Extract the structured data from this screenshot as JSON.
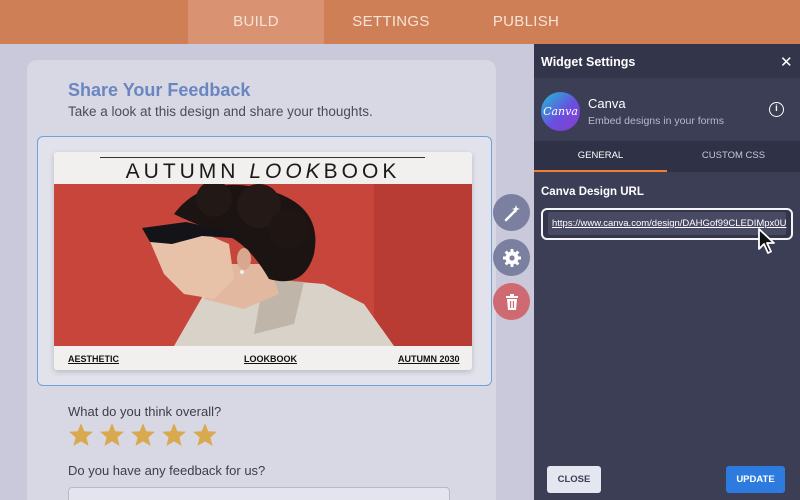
{
  "topnav": {
    "tabs": [
      {
        "label": "BUILD",
        "active": true
      },
      {
        "label": "SETTINGS",
        "active": false
      },
      {
        "label": "PUBLISH",
        "active": false
      }
    ],
    "color": "#cf7f55"
  },
  "form": {
    "title": "Share Your Feedback",
    "subtitle": "Take a look at this design and share your thoughts.",
    "lookbook": {
      "title_pre": "AUTUMN ",
      "title_em": "LOOK",
      "title_post": "BOOK",
      "footer": [
        "AESTHETIC",
        "LOOKBOOK",
        "AUTUMN 2030"
      ]
    },
    "question1": "What do you think overall?",
    "rating": {
      "value": 5,
      "max": 5
    },
    "question2": "Do you have any feedback for us?",
    "widget_tools": [
      "magic-wand-icon",
      "gear-icon",
      "trash-icon"
    ]
  },
  "panel": {
    "title": "Widget Settings",
    "close_icon": "close-icon",
    "app": {
      "name": "Canva",
      "logo_text": "Canva",
      "description": "Embed designs in your forms"
    },
    "tabs": [
      {
        "label": "GENERAL",
        "active": true
      },
      {
        "label": "CUSTOM CSS",
        "active": false
      }
    ],
    "field_label": "Canva Design URL",
    "url_value": "https://www.canva.com/design/DAHGof99CLEDIMpx0U",
    "close_label": "CLOSE",
    "update_label": "UPDATE",
    "accent": "#f08030",
    "update_color": "#2e7be0"
  }
}
